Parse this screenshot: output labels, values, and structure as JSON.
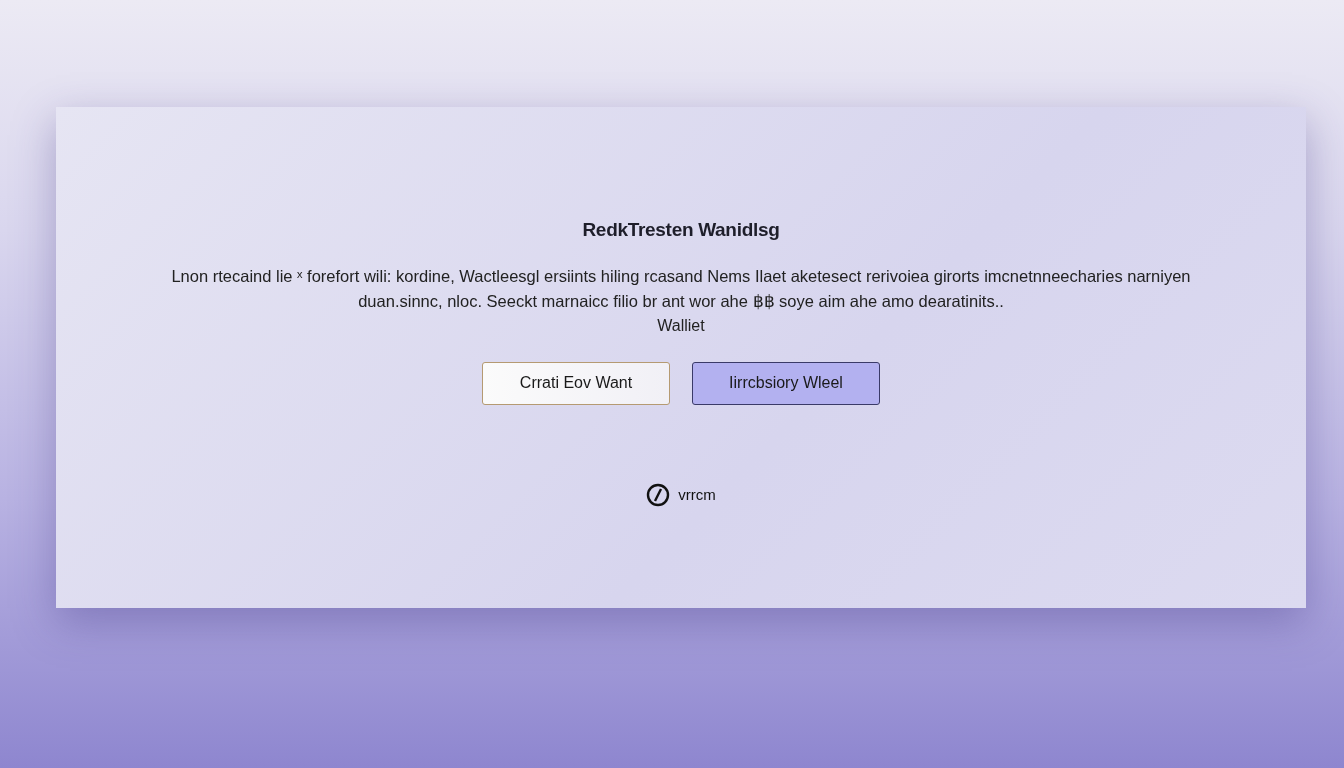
{
  "dialog": {
    "title": "RedkTresten Wanidlsg",
    "description_lines": [
      "Lnon rtecaind lie ˣ forefort wili: kordine, Wactleesgl ersiints hiling rcasand Nems Ilaet aketesect rerivoiea girorts imcnetnneecharies narniyen",
      "duan.sinnc, nloc. Seeckt marnaicc filio br ant wor ahe ฿฿ soye aim ahe amo dearatinits.."
    ],
    "note": "Walliet",
    "buttons": [
      {
        "kind": "secondary",
        "label": "Crrati Eov Want"
      },
      {
        "kind": "primary",
        "label": "Iirrcbsiory Wleel"
      }
    ],
    "footer": {
      "label": "vrrcm"
    }
  }
}
